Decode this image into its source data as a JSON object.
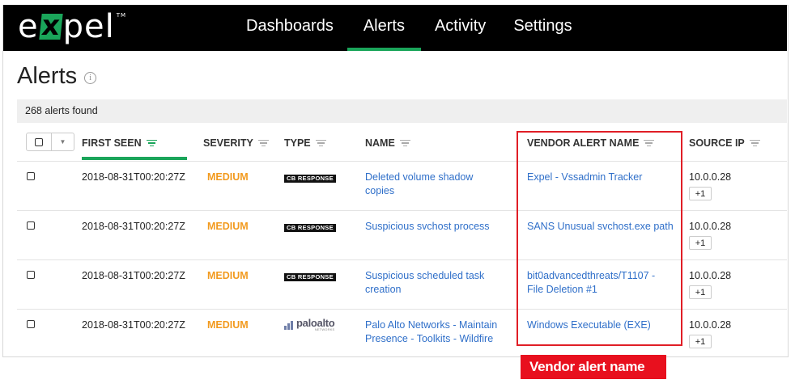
{
  "brand": {
    "logo_left": "e",
    "logo_x": "x",
    "logo_right": "pel",
    "logo_tm": "TM",
    "accent": "#1aa55a"
  },
  "nav": {
    "items": [
      {
        "label": "Dashboards"
      },
      {
        "label": "Alerts",
        "active": true
      },
      {
        "label": "Activity"
      },
      {
        "label": "Settings"
      }
    ]
  },
  "page": {
    "title": "Alerts",
    "info_glyph": "i",
    "count_text": "268 alerts found"
  },
  "table": {
    "columns": [
      "FIRST SEEN",
      "SEVERITY",
      "TYPE",
      "NAME",
      "VENDOR ALERT NAME",
      "SOURCE IP"
    ],
    "sorted_column": "FIRST SEEN",
    "rows": [
      {
        "first_seen": "2018-08-31T00:20:27Z",
        "severity": "MEDIUM",
        "type": "CB RESPONSE",
        "name": "Deleted volume shadow copies",
        "vendor_alert_name": "Expel - Vssadmin Tracker",
        "source_ip": "10.0.0.28",
        "extra": "+1"
      },
      {
        "first_seen": "2018-08-31T00:20:27Z",
        "severity": "MEDIUM",
        "type": "CB RESPONSE",
        "name": "Suspicious svchost process",
        "vendor_alert_name": "SANS Unusual svchost.exe path",
        "source_ip": "10.0.0.28",
        "extra": "+1"
      },
      {
        "first_seen": "2018-08-31T00:20:27Z",
        "severity": "MEDIUM",
        "type": "CB RESPONSE",
        "name": "Suspicious scheduled task creation",
        "vendor_alert_name": "bit0advancedthreats/T1107 - File Deletion #1",
        "source_ip": "10.0.0.28",
        "extra": "+1"
      },
      {
        "first_seen": "2018-08-31T00:20:27Z",
        "severity": "MEDIUM",
        "type": "paloalto",
        "type_sub": "NETWORKS",
        "name": "Palo Alto Networks - Maintain Presence - Toolkits - Wildfire",
        "vendor_alert_name": "Windows Executable (EXE)",
        "source_ip": "10.0.0.28",
        "extra": "+1"
      }
    ]
  },
  "annotation": {
    "label": "Vendor alert name",
    "color": "#e8101e"
  },
  "colors": {
    "severity_medium": "#f29a1e",
    "link": "#2f6fc9"
  }
}
